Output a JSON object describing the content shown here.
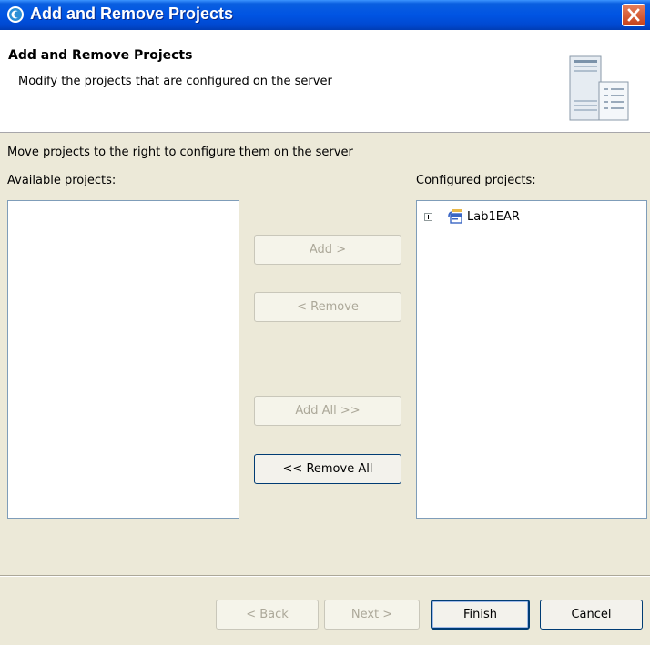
{
  "window": {
    "title": "Add and Remove Projects"
  },
  "header": {
    "title": "Add and Remove Projects",
    "description": "Modify the projects that are configured on the server"
  },
  "instructions": "Move projects to the right to configure them on the server",
  "available": {
    "label": "Available projects:",
    "items": []
  },
  "configured": {
    "label": "Configured projects:",
    "items": [
      {
        "label": "Lab1EAR",
        "icon": "ear-project-icon",
        "expanded": false
      }
    ]
  },
  "buttons": {
    "add": "Add >",
    "remove": "< Remove",
    "add_all": "Add All >>",
    "remove_all": "<< Remove All"
  },
  "footer": {
    "back": "< Back",
    "next": "Next >",
    "finish": "Finish",
    "cancel": "Cancel"
  },
  "colors": {
    "titlebar": "#0054E3",
    "dialog_bg": "#ECE9D8",
    "close_button": "#C7411A"
  }
}
